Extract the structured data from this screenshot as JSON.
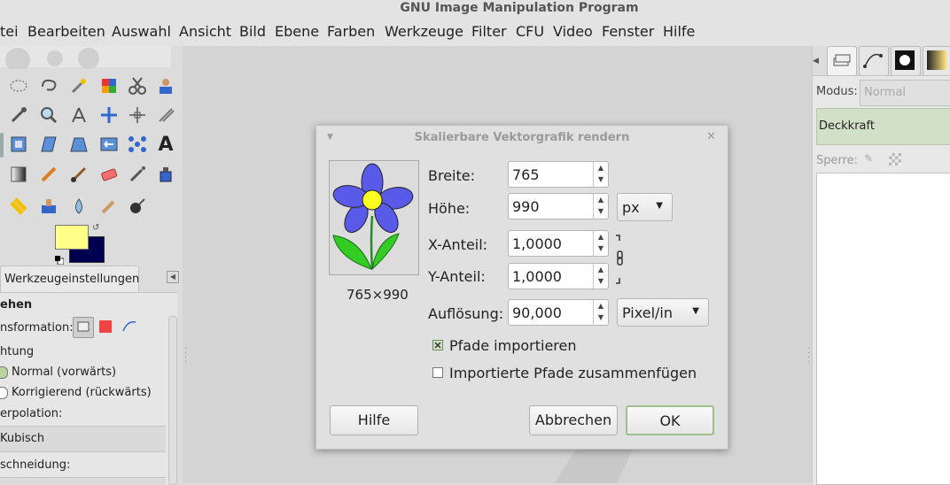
{
  "window": {
    "title": "GNU Image Manipulation Program"
  },
  "menu": [
    "tei",
    "Bearbeiten",
    "Auswahl",
    "Ansicht",
    "Bild",
    "Ebene",
    "Farben",
    "Werkzeuge",
    "Filter",
    "CFU",
    "Video",
    "Fenster",
    "Hilfe"
  ],
  "tool_options": {
    "tab_label": "Werkzeugeinstellungen",
    "section": "ehen",
    "transformation_label": "nsformation:",
    "direction_label": "htung",
    "direction_options": [
      "Normal (vorwärts)",
      "Korrigierend (rückwärts)"
    ],
    "interpolation_label": "erpolation:",
    "interpolation_value": "Kubisch",
    "clipping_label": "schneidung:"
  },
  "layers_panel": {
    "mode_label": "Modus:",
    "mode_value": "Normal",
    "opacity_label": "Deckkraft",
    "lock_label": "Sperre:"
  },
  "dialog": {
    "title": "Skalierbare Vektorgrafik rendern",
    "preview_size": "765×990",
    "width_label": "Breite:",
    "width_value": "765",
    "height_label": "Höhe:",
    "height_value": "990",
    "unit": "px",
    "xratio_label": "X-Anteil:",
    "xratio_value": "1,0000",
    "yratio_label": "Y-Anteil:",
    "yratio_value": "1,0000",
    "resolution_label": "Auflösung:",
    "resolution_value": "90,000",
    "resolution_unit": "Pixel/in",
    "import_paths_label": "Pfade importieren",
    "import_paths_checked": true,
    "merge_paths_label": "Importierte Pfade zusammenfügen",
    "merge_paths_checked": false,
    "help_button": "Hilfe",
    "cancel_button": "Abbrechen",
    "ok_button": "OK"
  },
  "colors": {
    "foreground": "#ffff88",
    "background": "#000050",
    "annotation_arrow": "#e02020",
    "accent_green": "#d3e0c8"
  }
}
